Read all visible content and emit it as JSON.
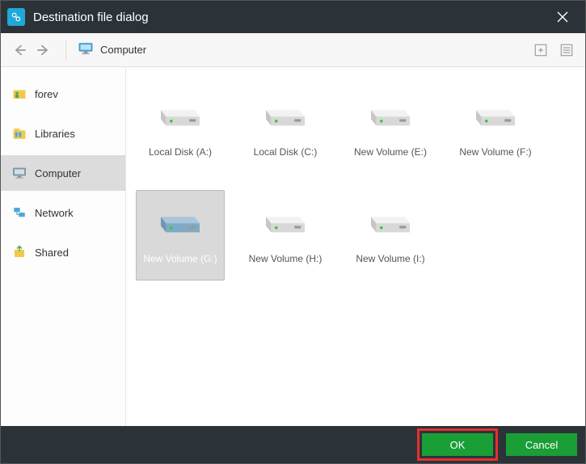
{
  "titlebar": {
    "title": "Destination file dialog"
  },
  "toolbar": {
    "location": "Computer"
  },
  "sidebar": {
    "items": [
      {
        "label": "forev",
        "id": "forev"
      },
      {
        "label": "Libraries",
        "id": "libraries"
      },
      {
        "label": "Computer",
        "id": "computer",
        "selected": true
      },
      {
        "label": "Network",
        "id": "network"
      },
      {
        "label": "Shared",
        "id": "shared"
      }
    ]
  },
  "drives": [
    {
      "label": "Local Disk (A:)",
      "selected": false
    },
    {
      "label": "Local Disk (C:)",
      "selected": false
    },
    {
      "label": "New Volume (E:)",
      "selected": false
    },
    {
      "label": "New Volume (F:)",
      "selected": false
    },
    {
      "label": "New Volume (G:)",
      "selected": true
    },
    {
      "label": "New Volume (H:)",
      "selected": false
    },
    {
      "label": "New Volume (I:)",
      "selected": false
    }
  ],
  "footer": {
    "ok": "OK",
    "cancel": "Cancel"
  }
}
